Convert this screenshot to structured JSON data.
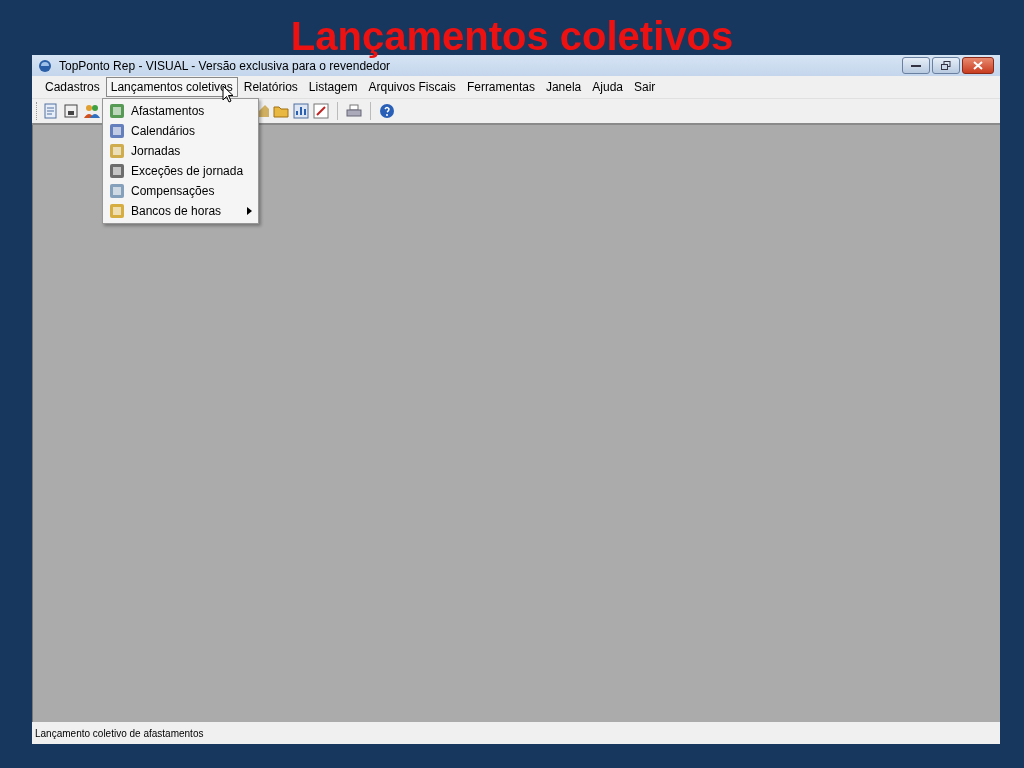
{
  "slide_title": "Lançamentos coletivos",
  "window": {
    "title": "TopPonto Rep - VISUAL - Versão exclusiva para o revendedor"
  },
  "menu_bar": [
    {
      "label": "Cadastros",
      "selected": false
    },
    {
      "label": "Lançamentos coletivos",
      "selected": true
    },
    {
      "label": "Relatórios",
      "selected": false
    },
    {
      "label": "Listagem",
      "selected": false
    },
    {
      "label": "Arquivos Fiscais",
      "selected": false
    },
    {
      "label": "Ferramentas",
      "selected": false
    },
    {
      "label": "Janela",
      "selected": false
    },
    {
      "label": "Ajuda",
      "selected": false
    },
    {
      "label": "Sair",
      "selected": false
    }
  ],
  "dropdown": [
    {
      "label": "Afastamentos",
      "submenu": false
    },
    {
      "label": "Calendários",
      "submenu": false
    },
    {
      "label": "Jornadas",
      "submenu": false
    },
    {
      "label": "Exceções de jornada",
      "submenu": false
    },
    {
      "label": "Compensações",
      "submenu": false
    },
    {
      "label": "Bancos de horas",
      "submenu": true
    }
  ],
  "status_bar": "Lançamento coletivo de afastamentos"
}
